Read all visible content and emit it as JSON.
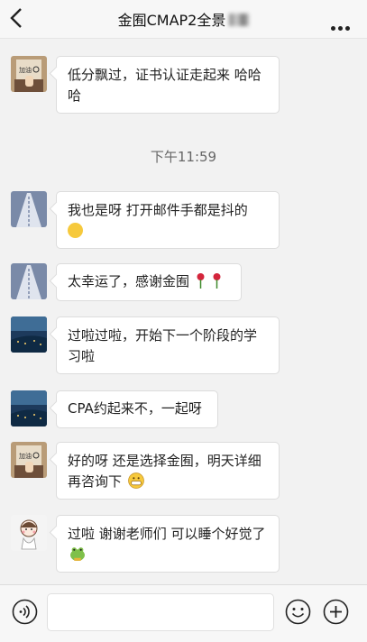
{
  "header": {
    "title": "金囿CMAP2全景",
    "back_icon": "chevron-left-icon",
    "more_icon": "more-dots-icon"
  },
  "timestamp": "下午11:59",
  "messages": [
    {
      "avatar": "jiayou-avatar",
      "text": "低分飘过，证书认证走起来 哈哈哈"
    },
    {
      "avatar": "road-avatar",
      "text": "我也是呀 打开邮件手都是抖的",
      "emoji": "thinking-emoji"
    },
    {
      "avatar": "road-avatar",
      "text": "太幸运了，感谢金囿",
      "emoji": "rose-emoji"
    },
    {
      "avatar": "city-avatar",
      "text": "过啦过啦，开始下一个阶段的学习啦"
    },
    {
      "avatar": "city-avatar",
      "text": "CPA约起来不，一起呀"
    },
    {
      "avatar": "jiayou-avatar",
      "text": "好的呀 还是选择金囿，明天详细再咨询下",
      "emoji": "grin-emoji"
    },
    {
      "avatar": "cartoon-girl-avatar",
      "text": "过啦 谢谢老师们 可以睡个好觉了",
      "emoji": "frog-emoji"
    }
  ],
  "input_bar": {
    "voice_icon": "voice-icon",
    "input_value": "",
    "emoji_icon": "smiley-icon",
    "plus_icon": "plus-icon"
  },
  "colors": {
    "background": "#f2f2f2",
    "bubble": "#ffffff",
    "bubble_border": "#dcdcdc",
    "header": "#f7f7f7"
  }
}
